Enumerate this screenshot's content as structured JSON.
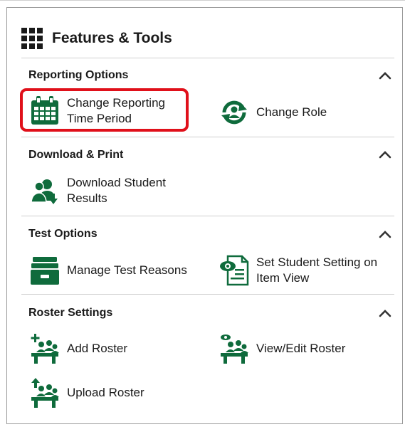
{
  "panel": {
    "title": "Features & Tools",
    "title_icon": "grid-icon"
  },
  "sections": [
    {
      "title": "Reporting Options",
      "expanded": true,
      "tools": [
        {
          "label": "Change Reporting Time Period",
          "icon": "calendar-icon",
          "highlighted": true
        },
        {
          "label": "Change Role",
          "icon": "change-role-icon"
        }
      ]
    },
    {
      "title": "Download & Print",
      "expanded": true,
      "tools": [
        {
          "label": "Download Student Results",
          "icon": "download-students-icon"
        }
      ]
    },
    {
      "title": "Test Options",
      "expanded": true,
      "tools": [
        {
          "label": "Manage Test Reasons",
          "icon": "file-drawer-icon"
        },
        {
          "label": "Set Student Setting on Item View",
          "icon": "view-settings-icon"
        }
      ]
    },
    {
      "title": "Roster Settings",
      "expanded": true,
      "tools": [
        {
          "label": "Add Roster",
          "icon": "add-roster-icon"
        },
        {
          "label": "View/Edit Roster",
          "icon": "view-roster-icon"
        },
        {
          "label": "Upload Roster",
          "icon": "upload-roster-icon"
        }
      ]
    }
  ],
  "colors": {
    "accent_green": "#0f6b3c",
    "highlight_red": "#e0101a",
    "text": "#1a1a1a",
    "divider": "#cfcfcf"
  }
}
